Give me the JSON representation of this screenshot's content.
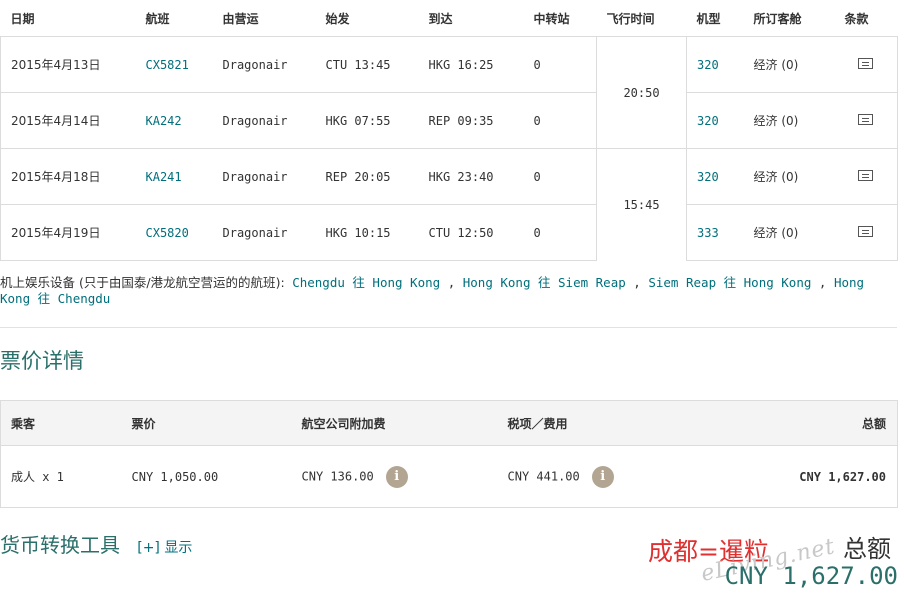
{
  "flights": {
    "headers": [
      "日期",
      "航班",
      "由营运",
      "始发",
      "到达",
      "中转站",
      "飞行时间",
      "机型",
      "所订客舱",
      "条款"
    ],
    "rows": [
      {
        "date": "2015年4月13日",
        "flight": "CX5821",
        "operator": "Dragonair",
        "depart": "CTU 13:45",
        "arrive": "HKG 16:25",
        "stops": "0",
        "aircraft": "320",
        "cabin": "经济 (0)"
      },
      {
        "date": "2015年4月14日",
        "flight": "KA242",
        "operator": "Dragonair",
        "depart": "HKG 07:55",
        "arrive": "REP 09:35",
        "stops": "0",
        "aircraft": "320",
        "cabin": "经济 (0)"
      },
      {
        "date": "2015年4月18日",
        "flight": "KA241",
        "operator": "Dragonair",
        "depart": "REP 20:05",
        "arrive": "HKG 23:40",
        "stops": "0",
        "aircraft": "320",
        "cabin": "经济 (0)"
      },
      {
        "date": "2015年4月19日",
        "flight": "CX5820",
        "operator": "Dragonair",
        "depart": "HKG 10:15",
        "arrive": "CTU 12:50",
        "stops": "0",
        "aircraft": "333",
        "cabin": "经济 (0)"
      }
    ],
    "durations": [
      "20:50",
      "15:45"
    ],
    "terms_icon": "document-icon"
  },
  "entertainment": {
    "label": "机上娱乐设备 (只于由国泰/港龙航空营运的的航班):",
    "links": [
      "Chengdu 往 Hong Kong",
      "Hong Kong 往 Siem Reap",
      "Siem Reap 往 Hong Kong",
      "Hong Kong 往 Chengdu"
    ],
    "separator": ","
  },
  "fare": {
    "title": "票价详情",
    "headers": [
      "乘客",
      "票价",
      "航空公司附加费",
      "税项／费用",
      "总额"
    ],
    "row": {
      "passenger": "成人 x 1",
      "fare": "CNY 1,050.00",
      "surcharge": "CNY 136.00",
      "taxes": "CNY 441.00",
      "total": "CNY 1,627.00"
    },
    "info_icon": "i"
  },
  "currency_tool": {
    "title": "货币转换工具",
    "toggle": "[+] 显示"
  },
  "watermark": {
    "red_text": "成都=暹粒",
    "script_text": "eLiving.net"
  },
  "grand_total": {
    "label": "总额",
    "amount": "CNY 1,627.00"
  },
  "colors": {
    "link": "#006f7c",
    "heading": "#2a6f6a",
    "border": "#dcdcdc",
    "info_icon_bg": "#b2a693",
    "watermark_red": "#e03030"
  }
}
